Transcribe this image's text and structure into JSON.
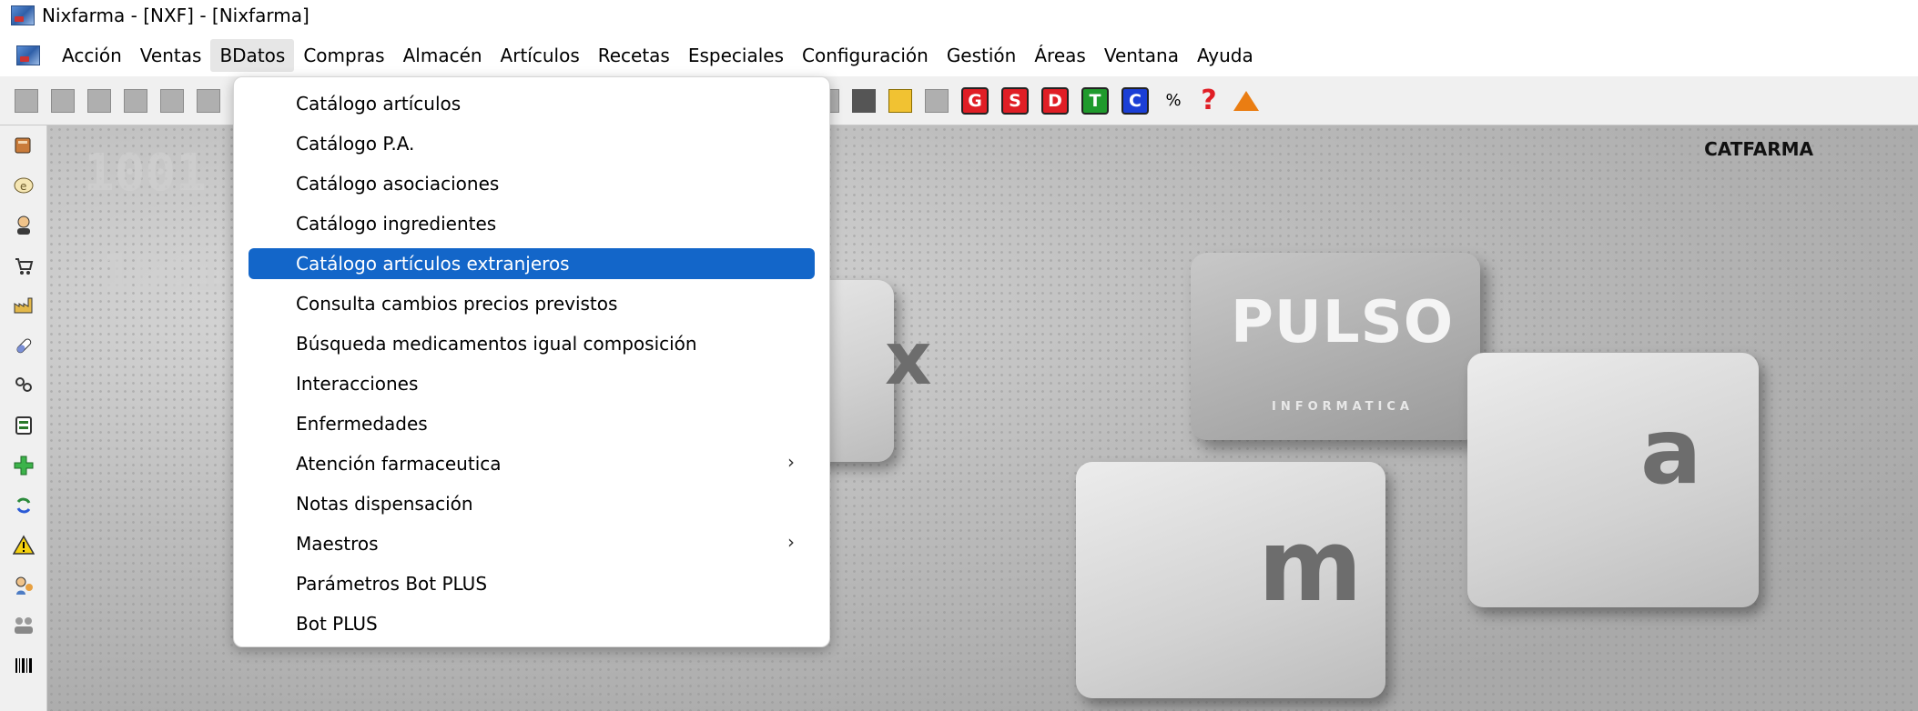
{
  "window": {
    "title": "Nixfarma - [NXF] - [Nixfarma]"
  },
  "menubar": {
    "items": [
      "Acción",
      "Ventas",
      "BDatos",
      "Compras",
      "Almacén",
      "Artículos",
      "Recetas",
      "Especiales",
      "Configuración",
      "Gestión",
      "Áreas",
      "Ventana",
      "Ayuda"
    ],
    "open_index": 2
  },
  "toolbar": {
    "letter_buttons": [
      {
        "label": "G",
        "color": "#e01e25"
      },
      {
        "label": "S",
        "color": "#e01e25"
      },
      {
        "label": "D",
        "color": "#e01e25"
      },
      {
        "label": "T",
        "color": "#1f9a2c"
      },
      {
        "label": "C",
        "color": "#1b3fd6"
      }
    ],
    "percent_label": "%",
    "help_label": "?"
  },
  "dropdown": {
    "items": [
      {
        "label": "Catálogo artículos"
      },
      {
        "label": "Catálogo P.A."
      },
      {
        "label": "Catálogo asociaciones"
      },
      {
        "label": "Catálogo ingredientes"
      },
      {
        "label": "Catálogo artículos extranjeros",
        "highlighted": true
      },
      {
        "label": "Consulta cambios precios previstos"
      },
      {
        "label": "Búsqueda medicamentos igual composición"
      },
      {
        "label": "Interacciones"
      },
      {
        "label": "Enfermedades"
      },
      {
        "label": "Atención farmaceutica",
        "submenu": true
      },
      {
        "label": "Notas dispensación"
      },
      {
        "label": "Maestros",
        "submenu": true
      },
      {
        "label": "Parámetros Bot PLUS"
      },
      {
        "label": "Bot PLUS"
      }
    ],
    "submenu_arrow": "›"
  },
  "desktop": {
    "corner_label": "CATFARMA",
    "logo_text": "PULSO",
    "logo_subtext": "INFORMATICA",
    "key_letters": [
      "x",
      "m",
      "a"
    ]
  },
  "sidebar_icons": [
    "book-icon",
    "e-icon",
    "user-icon",
    "cart-icon",
    "factory-icon",
    "pill-icon",
    "people-icon",
    "printer-icon",
    "plus-icon",
    "refresh-icon",
    "warning-icon",
    "person-icon",
    "group-icon",
    "barcode-icon"
  ],
  "colors": {
    "highlight": "#1366c9",
    "toolbar_bg": "#f0f0f0"
  }
}
